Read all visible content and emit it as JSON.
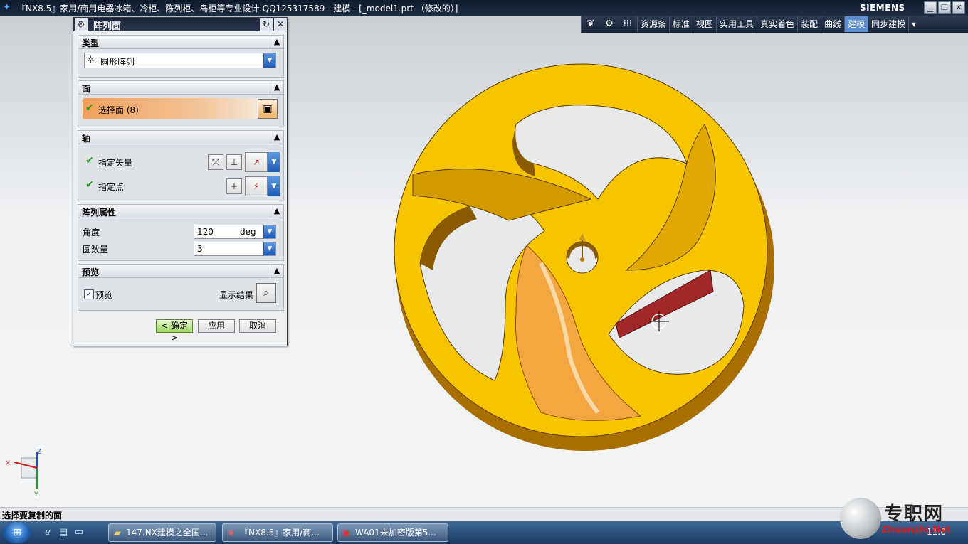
{
  "window": {
    "title": "『NX8.5』家用/商用电器冰箱、冷柜、陈列柜、岛柜等专业设计-QQ125317589 - 建模 - [_model1.prt （修改的）]",
    "brand": "SIEMENS",
    "minimize": "▁",
    "restore": "❐",
    "close": "✕"
  },
  "toolbar": {
    "items": [
      "资源条",
      "标准",
      "视图",
      "实用工具",
      "真实着色",
      "装配",
      "曲线",
      "建模",
      "同步建模"
    ],
    "active": "建模"
  },
  "dialog": {
    "title": "阵列面",
    "sections": {
      "type": {
        "label": "类型",
        "value": "圆形阵列"
      },
      "face": {
        "label": "面",
        "select_label": "选择面 (8)"
      },
      "axis": {
        "label": "轴",
        "vector_label": "指定矢量",
        "point_label": "指定点"
      },
      "props": {
        "label": "阵列属性",
        "angle_label": "角度",
        "angle_value": "120",
        "angle_unit": "deg",
        "count_label": "圆数量",
        "count_value": "3"
      },
      "preview": {
        "label": "预览",
        "checkbox_label": "预览",
        "checked": true,
        "show_result_label": "显示结果"
      }
    },
    "buttons": {
      "ok": "< 确定 >",
      "apply": "应用",
      "cancel": "取消"
    }
  },
  "triad": {
    "x": "X",
    "y": "Y",
    "z": "Z"
  },
  "status": {
    "text": "选择要复制的面"
  },
  "taskbar": {
    "tasks": [
      "147.NX建模之全国...",
      "『NX8.5』家用/商...",
      "WA01未加密版第5..."
    ],
    "clock": "11:0"
  },
  "watermark": {
    "text": "专职网",
    "url": "Zhuanzhi.Net"
  },
  "colors": {
    "part_yellow": "#f7c500",
    "part_shade": "#b07a00",
    "selected_face": "#a02828",
    "accent_blue": "#5b8fd1"
  }
}
